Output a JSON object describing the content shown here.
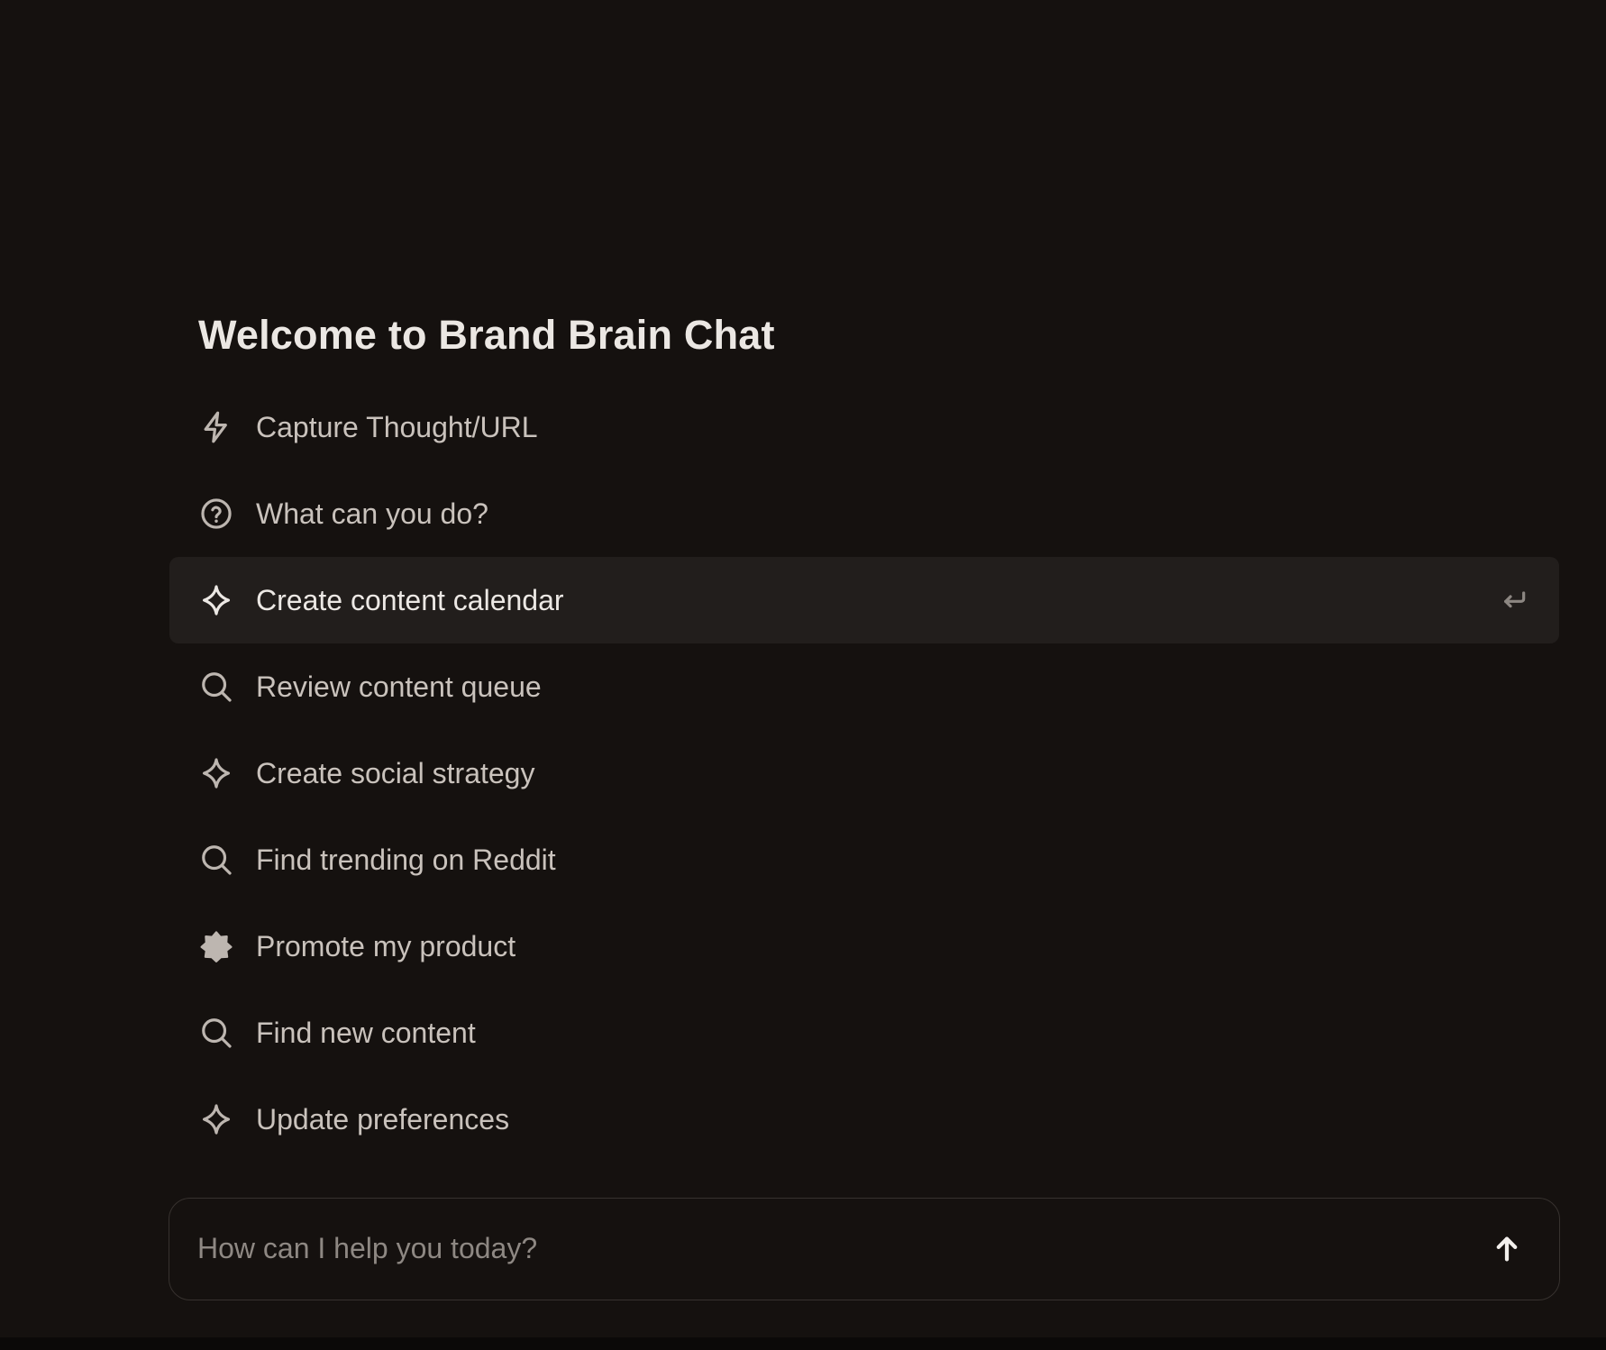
{
  "welcome": {
    "title": "Welcome to Brand Brain Chat"
  },
  "suggestions": [
    {
      "label": "Capture Thought/URL",
      "icon": "lightning-icon"
    },
    {
      "label": "What can you do?",
      "icon": "question-circle-icon"
    },
    {
      "label": "Create content calendar",
      "icon": "sparkle-icon",
      "highlighted": true
    },
    {
      "label": "Review content queue",
      "icon": "search-icon"
    },
    {
      "label": "Create social strategy",
      "icon": "sparkle-icon"
    },
    {
      "label": "Find trending on Reddit",
      "icon": "search-icon"
    },
    {
      "label": "Promote my product",
      "icon": "star-badge-icon"
    },
    {
      "label": "Find new content",
      "icon": "search-icon"
    },
    {
      "label": "Update preferences",
      "icon": "sparkle-icon"
    }
  ],
  "composer": {
    "placeholder": "How can I help you today?",
    "value": ""
  },
  "colors": {
    "background": "#15110f",
    "highlight_row": "#221e1c",
    "text_primary": "#ebe7e3",
    "text_secondary": "#c9c2bc",
    "placeholder": "#8e8883",
    "border": "#37322f"
  }
}
